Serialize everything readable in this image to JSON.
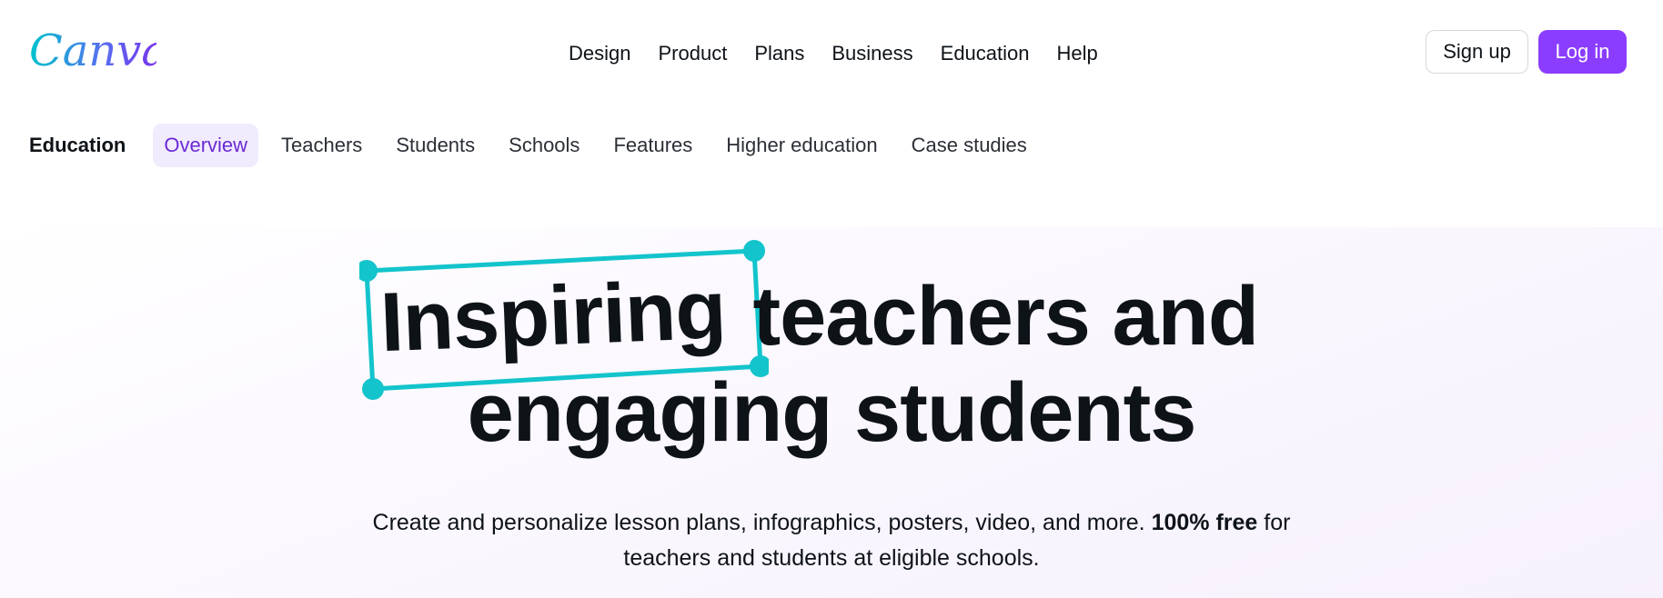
{
  "header": {
    "logo_text": "Canva",
    "nav": [
      "Design",
      "Product",
      "Plans",
      "Business",
      "Education",
      "Help"
    ],
    "signup_label": "Sign up",
    "login_label": "Log in"
  },
  "subnav": {
    "section_label": "Education",
    "items": [
      "Overview",
      "Teachers",
      "Students",
      "Schools",
      "Features",
      "Higher education",
      "Case studies"
    ],
    "active": "Overview"
  },
  "hero": {
    "highlight_word": "Inspiring",
    "line1_rest": "teachers and",
    "line2": "engaging students",
    "tagline_part1": "Create and personalize lesson plans, infographics, posters, video, and more.",
    "tagline_bold": "100% free",
    "tagline_part2": "for",
    "tagline_line2": "teachers and students at eligible schools."
  },
  "colors": {
    "brand_purple": "#8b3dff",
    "active_tab_bg": "#f1ebfe",
    "active_tab_text": "#6c2ad3",
    "selection_teal": "#13c4cc"
  }
}
